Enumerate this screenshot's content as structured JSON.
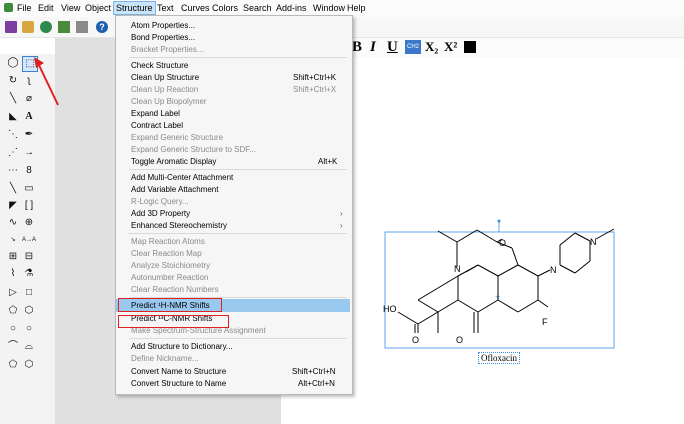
{
  "menubar": {
    "items": [
      "File",
      "Edit",
      "View",
      "Object",
      "Structure",
      "Text",
      "Curves",
      "Colors",
      "Search",
      "Add-ins",
      "Window",
      "Help"
    ],
    "active": "Structure"
  },
  "format_bar": {
    "bold": "B",
    "italic": "I",
    "underline": "U",
    "subscript": "X₂",
    "superscript": "X²"
  },
  "menu": {
    "items": [
      {
        "label": "Atom Properties...",
        "disabled": false
      },
      {
        "label": "Bond Properties...",
        "disabled": false
      },
      {
        "label": "Bracket Properties...",
        "disabled": true
      },
      {
        "label": "Check Structure",
        "disabled": false
      },
      {
        "label": "Clean Up Structure",
        "shortcut": "Shift+Ctrl+K",
        "disabled": false
      },
      {
        "label": "Clean Up Reaction",
        "shortcut": "Shift+Ctrl+X",
        "disabled": true
      },
      {
        "label": "Clean Up Biopolymer",
        "disabled": true
      },
      {
        "label": "Expand Label",
        "disabled": false
      },
      {
        "label": "Contract Label",
        "disabled": false
      },
      {
        "label": "Expand Generic Structure",
        "disabled": true
      },
      {
        "label": "Expand Generic Structure to SDF...",
        "disabled": true
      },
      {
        "label": "Toggle Aromatic Display",
        "shortcut": "Alt+K",
        "disabled": false
      },
      {
        "label": "Add Multi-Center Attachment",
        "disabled": false
      },
      {
        "label": "Add Variable Attachment",
        "disabled": false
      },
      {
        "label": "R-Logic Query...",
        "disabled": true
      },
      {
        "label": "Add 3D Property",
        "submenu": true,
        "disabled": false
      },
      {
        "label": "Enhanced Stereochemistry",
        "submenu": true,
        "disabled": false
      },
      {
        "label": "Map Reaction Atoms",
        "disabled": true
      },
      {
        "label": "Clear Reaction Map",
        "disabled": true
      },
      {
        "label": "Analyze Stoichiometry",
        "disabled": true
      },
      {
        "label": "Autonumber Reaction",
        "disabled": true
      },
      {
        "label": "Clear Reaction Numbers",
        "disabled": true
      },
      {
        "label": "Predict ¹H-NMR Shifts",
        "disabled": false,
        "highlighted": true
      },
      {
        "label": "Predict ¹³C-NMR Shifts",
        "disabled": false
      },
      {
        "label": "Make Spectrum-Structure Assignment",
        "disabled": true
      },
      {
        "label": "Add Structure to Dictionary...",
        "disabled": false
      },
      {
        "label": "Define Nickname...",
        "disabled": true
      },
      {
        "label": "Convert Name to Structure",
        "shortcut": "Shift+Ctrl+N",
        "disabled": false
      },
      {
        "label": "Convert Structure to Name",
        "shortcut": "Alt+Ctrl+N",
        "disabled": false
      }
    ]
  },
  "structure": {
    "atoms": {
      "o_ring": "O",
      "n_ring": "N",
      "n_pip": "N",
      "n_methyl": "N",
      "ho": "HO",
      "f": "F",
      "o_acid": "O",
      "o_ketone": "O"
    },
    "caption": "Ofloxacin"
  },
  "colors": {
    "highlight": "#99c9ef",
    "annotation": "#e02020",
    "selection": "#3a8ee6"
  }
}
